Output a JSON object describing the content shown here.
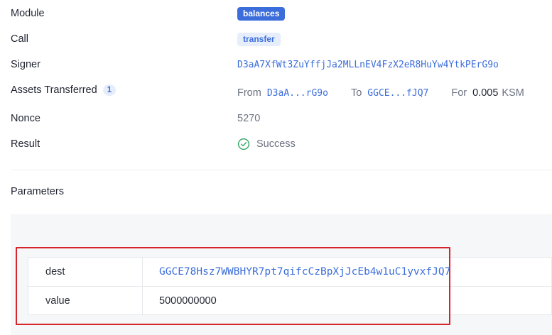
{
  "details": {
    "module": {
      "label": "Module",
      "value": "balances"
    },
    "call": {
      "label": "Call",
      "value": "transfer"
    },
    "signer": {
      "label": "Signer",
      "value": "D3aA7XfWt3ZuYffjJa2MLLnEV4FzX2eR8HuYw4YtkPErG9o"
    },
    "assets": {
      "label": "Assets Transferred",
      "count": "1",
      "from_label": "From",
      "from_value": "D3aA...rG9o",
      "to_label": "To",
      "to_value": "GGCE...fJQ7",
      "for_label": "For",
      "amount": "0.005",
      "unit": "KSM"
    },
    "nonce": {
      "label": "Nonce",
      "value": "5270"
    },
    "result": {
      "label": "Result",
      "value": "Success",
      "icon": "check-circle-icon"
    }
  },
  "parameters": {
    "title": "Parameters",
    "rows": [
      {
        "key": "dest",
        "value": "GGCE78Hsz7WWBHYR7pt7qifcCzBpXjJcEb4w1uC1yvxfJQ7"
      },
      {
        "key": "value",
        "value": "5000000000"
      }
    ]
  },
  "colors": {
    "accent": "#3b6ddb",
    "success": "#3aa76d",
    "highlight": "#d6262b"
  }
}
